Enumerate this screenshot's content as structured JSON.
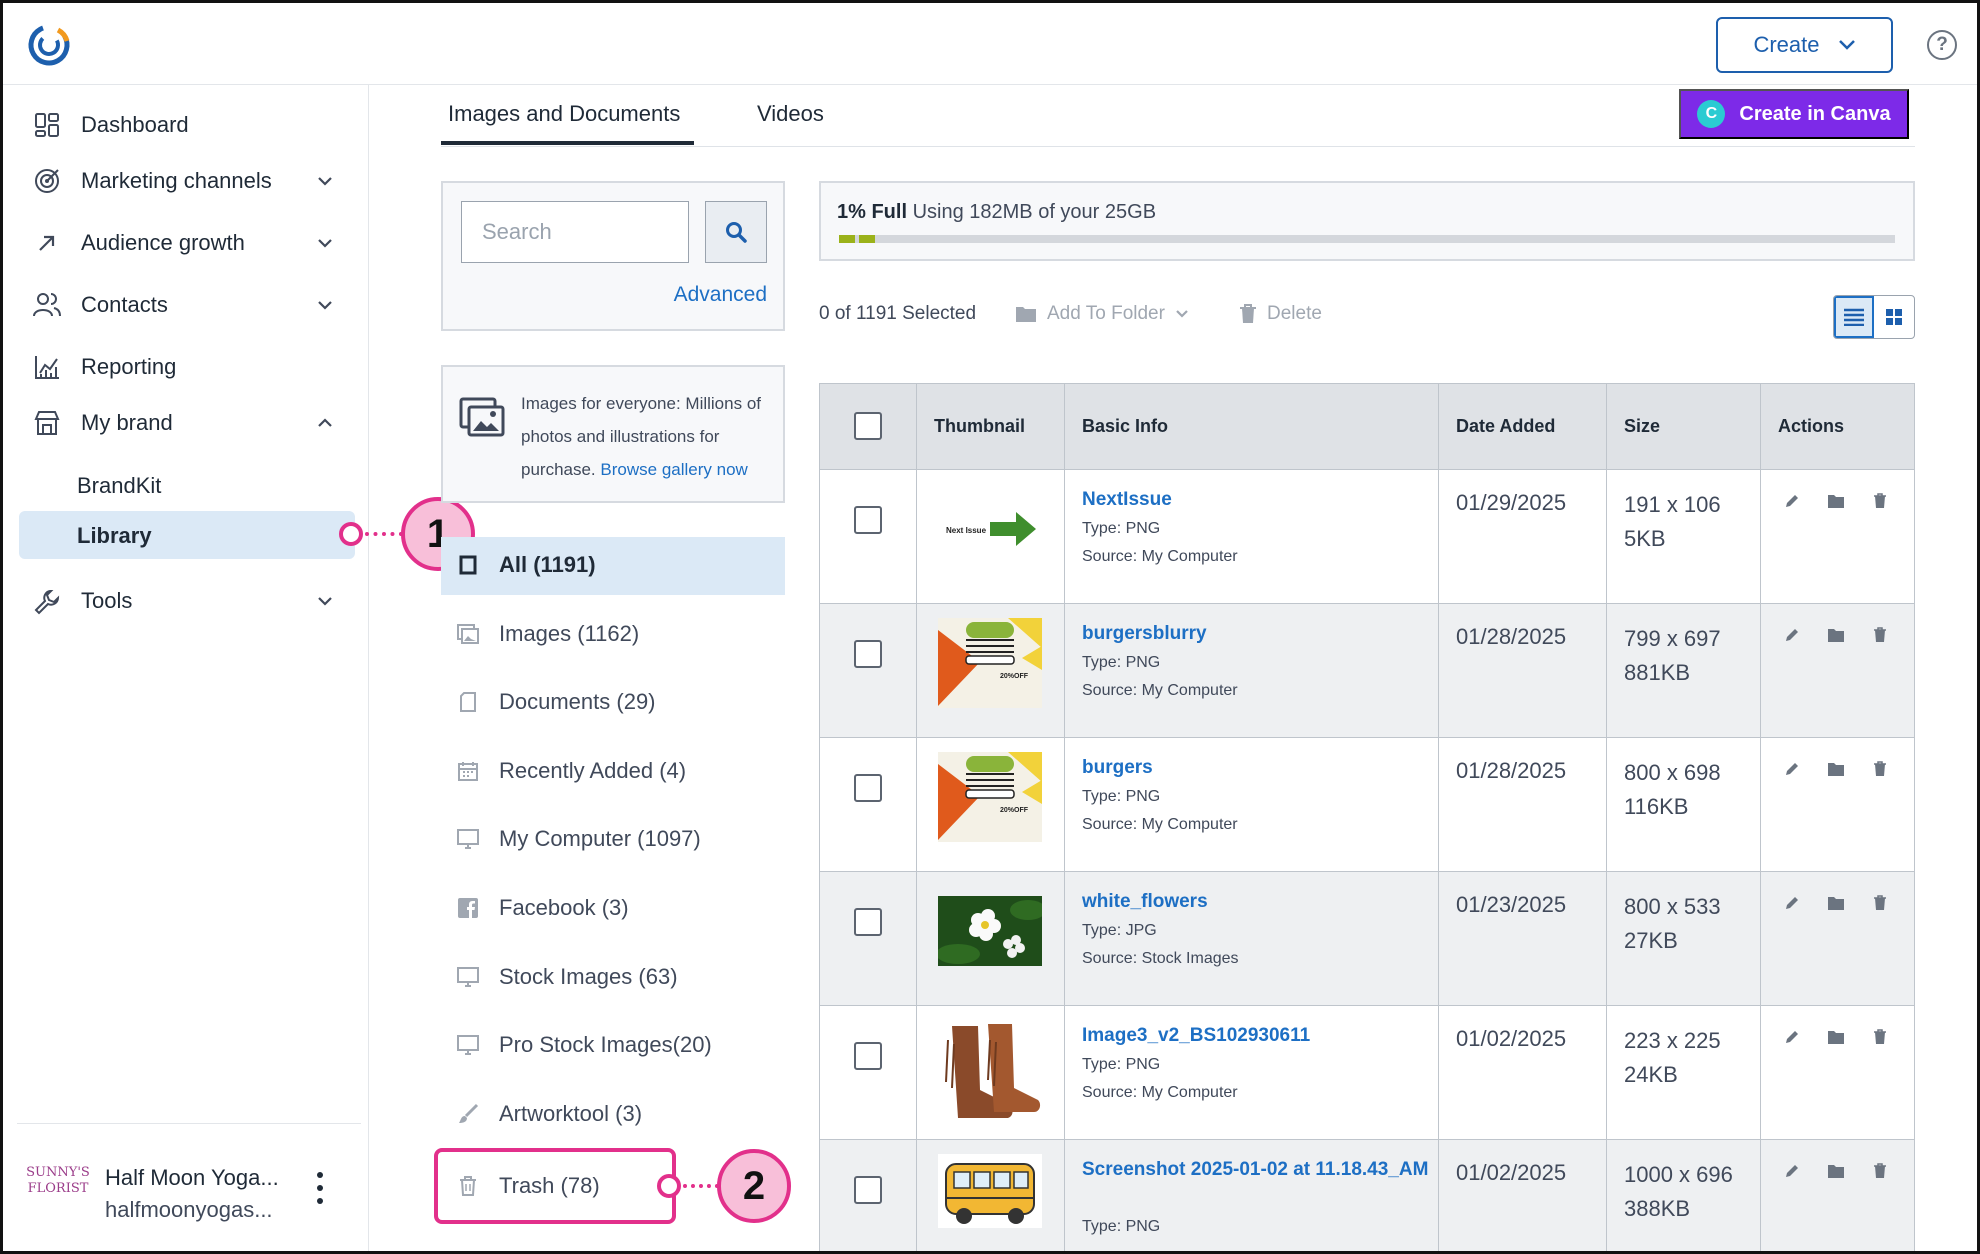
{
  "header": {
    "create_label": "Create",
    "help_label": "?"
  },
  "nav": {
    "items": [
      {
        "label": "Dashboard"
      },
      {
        "label": "Marketing channels"
      },
      {
        "label": "Audience growth"
      },
      {
        "label": "Contacts"
      },
      {
        "label": "Reporting"
      },
      {
        "label": "My brand"
      },
      {
        "label": "Tools"
      }
    ],
    "sub_items": [
      {
        "label": "BrandKit"
      },
      {
        "label": "Library"
      }
    ],
    "account": {
      "name": "Half Moon Yoga...",
      "email": "halfmoonyogas...",
      "avatar_text": "SUNNY'S FLORIST"
    }
  },
  "callouts": [
    "1",
    "2"
  ],
  "tabs": [
    {
      "label": "Images and Documents"
    },
    {
      "label": "Videos"
    }
  ],
  "canva": {
    "label": "Create in Canva",
    "badge": "C"
  },
  "search": {
    "placeholder": "Search",
    "advanced_label": "Advanced"
  },
  "promo": {
    "text": "Images for everyone: Millions of photos and illustrations for purchase.",
    "link": "Browse gallery now"
  },
  "folders": [
    {
      "label": "All (1191)",
      "icon": "all-icon"
    },
    {
      "label": "Images (1162)",
      "icon": "images-icon"
    },
    {
      "label": "Documents (29)",
      "icon": "document-icon"
    },
    {
      "label": "Recently Added (4)",
      "icon": "calendar-icon"
    },
    {
      "label": "My Computer (1097)",
      "icon": "monitor-icon"
    },
    {
      "label": "Facebook (3)",
      "icon": "facebook-icon"
    },
    {
      "label": "Stock Images (63)",
      "icon": "monitor-icon"
    },
    {
      "label": "Pro Stock Images(20)",
      "icon": "monitor-icon"
    },
    {
      "label": "Artworktool (3)",
      "icon": "brush-icon"
    },
    {
      "label": "Trash (78)",
      "icon": "trash-icon"
    }
  ],
  "storage": {
    "percent_label": "1% Full",
    "usage_text": "Using 182MB of your 25GB",
    "fraction_used": 0.01
  },
  "toolbar": {
    "selected_text": "0 of 1191 Selected",
    "add_to_folder": "Add To Folder",
    "delete": "Delete"
  },
  "table": {
    "headers": [
      "Thumbnail",
      "Basic Info",
      "Date Added",
      "Size",
      "Actions"
    ],
    "rows": [
      {
        "name": "NextIssue",
        "type": "Type: PNG",
        "source": "Source: My Computer",
        "date": "01/29/2025",
        "dimensions": "191 x 106",
        "size": "5KB",
        "thumb_label": "Next Issue"
      },
      {
        "name": "burgersblurry",
        "type": "Type: PNG",
        "source": "Source: My Computer",
        "date": "01/28/2025",
        "dimensions": "799 x 697",
        "size": "881KB",
        "thumb_label": "20%OFF"
      },
      {
        "name": "burgers",
        "type": "Type: PNG",
        "source": "Source: My Computer",
        "date": "01/28/2025",
        "dimensions": "800 x 698",
        "size": "116KB",
        "thumb_label": "20%OFF"
      },
      {
        "name": "white_flowers",
        "type": "Type: JPG",
        "source": "Source: Stock Images",
        "date": "01/23/2025",
        "dimensions": "800 x 533",
        "size": "27KB",
        "thumb_label": ""
      },
      {
        "name": "Image3_v2_BS102930611",
        "type": "Type: PNG",
        "source": "Source: My Computer",
        "date": "01/02/2025",
        "dimensions": "223 x 225",
        "size": "24KB",
        "thumb_label": ""
      },
      {
        "name": "Screenshot 2025-01-02 at 11.18.43_AM",
        "type": "Type: PNG",
        "source": "",
        "date": "01/02/2025",
        "dimensions": "1000 x 696",
        "size": "388KB",
        "thumb_label": ""
      }
    ]
  },
  "colors": {
    "accent": "#1d6fc4",
    "canva": "#7d2ae8",
    "callout": "#e2308b",
    "selected_bg": "#dbe9f6"
  }
}
